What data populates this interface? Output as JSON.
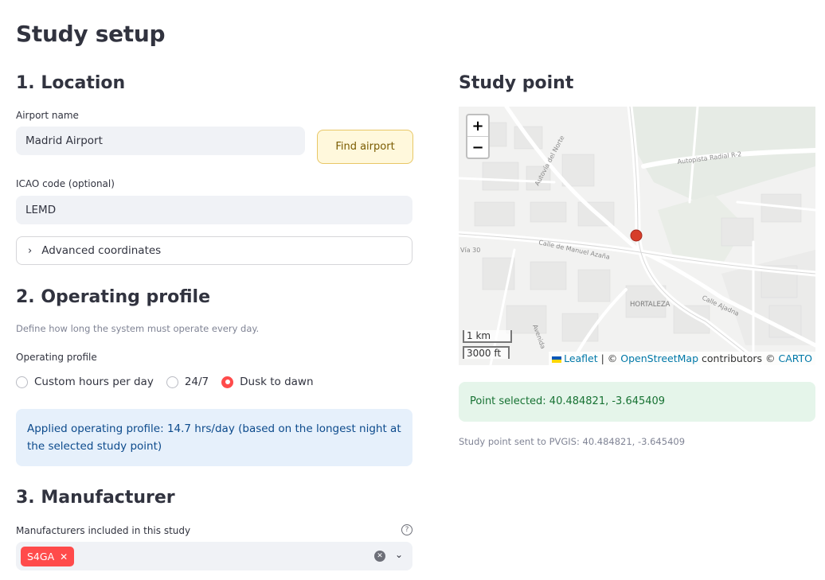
{
  "page_title": "Study setup",
  "location": {
    "heading": "1. Location",
    "airport_label": "Airport name",
    "airport_value": "Madrid Airport",
    "find_button": "Find airport",
    "icao_label": "ICAO code (optional)",
    "icao_value": "LEMD",
    "expander_label": "Advanced coordinates"
  },
  "operating": {
    "heading": "2. Operating profile",
    "caption": "Define how long the system must operate every day.",
    "radio_label": "Operating profile",
    "options": [
      "Custom hours per day",
      "24/7",
      "Dusk to dawn"
    ],
    "selected": "Dusk to dawn",
    "info": "Applied operating profile: 14.7 hrs/day (based on the longest night at the selected study point)"
  },
  "manufacturer": {
    "heading": "3. Manufacturer",
    "label": "Manufacturers included in this study",
    "chips": [
      "S4GA"
    ]
  },
  "study_point": {
    "heading": "Study point",
    "map": {
      "zoom_in": "+",
      "zoom_out": "−",
      "scale_metric": "1 km",
      "scale_imperial": "3000 ft",
      "attribution": {
        "leaflet": "Leaflet",
        "sep": " | © ",
        "osm": "OpenStreetMap",
        "contributors": " contributors © ",
        "carto": "CARTO"
      },
      "labels": {
        "road1": "Autopista Radial R-2",
        "road2": "Autovía del Norte",
        "road3": "Calle de Manuel Azaña",
        "road4": "Calle Ajadna",
        "road5": "Avenida",
        "road6": "Vía 30",
        "district": "HORTALEZA"
      },
      "marker_color": "#d63e2a"
    },
    "success": "Point selected: 40.484821, -3.645409",
    "caption": "Study point sent to PVGIS: 40.484821, -3.645409"
  }
}
